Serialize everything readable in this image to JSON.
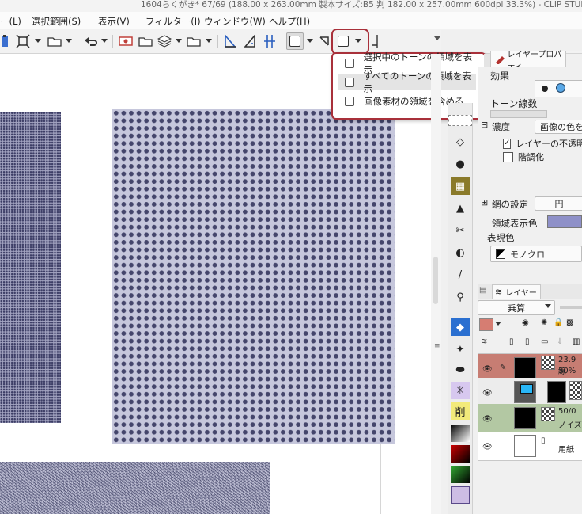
{
  "title_bar": {
    "text": "1604らくがき* 67/69 (188.00 x 263.00mm 製本サイズ:B5 判 182.00 x 257.00mm 600dpi 33.3%)  - CLIP STUDIO"
  },
  "menu": {
    "items": [
      "ー(L)",
      "選択範囲(S)",
      "表示(V)",
      "フィルター(I)",
      "ウィンドウ(W)",
      "ヘルプ(H)"
    ]
  },
  "dropdown": {
    "items": [
      {
        "label": "選択中のトーンの領域を表示",
        "checked": false
      },
      {
        "label": "すべてのトーンの領域を表示",
        "checked": false,
        "hovered": true
      },
      {
        "label": "画像素材の領域を含める",
        "checked": false
      }
    ]
  },
  "layer_property": {
    "tab_label": "レイヤープロパティ",
    "effect_label": "効果",
    "tone_lines_label": "トーン線数",
    "density_label": "濃度",
    "density_value": "画像の色を",
    "layer_opacity_label": "レイヤーの不透明",
    "layer_opacity_checked": true,
    "posterize_label": "階調化",
    "posterize_checked": false,
    "dot_settings_label": "網の設定",
    "dot_settings_value": "円",
    "area_color_label": "領域表示色",
    "area_color": "#8e90c8",
    "expression_color_label": "表現色",
    "expression_color_value": "モノクロ"
  },
  "layer_panel": {
    "tab_label": "レイヤー",
    "blend_mode": "乗算",
    "layers": [
      {
        "line1": "23.9線",
        "line2": "30%",
        "color": "#c77d73"
      },
      {
        "line1": "",
        "line2": "",
        "color": "#ececec"
      },
      {
        "line1": "50/0",
        "line2": "ノイズ",
        "color": "#b3c8a3"
      },
      {
        "line1": "用紙",
        "line2": "",
        "color": "#ffffff"
      }
    ]
  },
  "tool_palette": {
    "delete_label": "削"
  },
  "colors": {
    "highlight_border": "#a8303a",
    "tone_dot": "#44456b",
    "tone_bg": "#c6c7dc"
  }
}
